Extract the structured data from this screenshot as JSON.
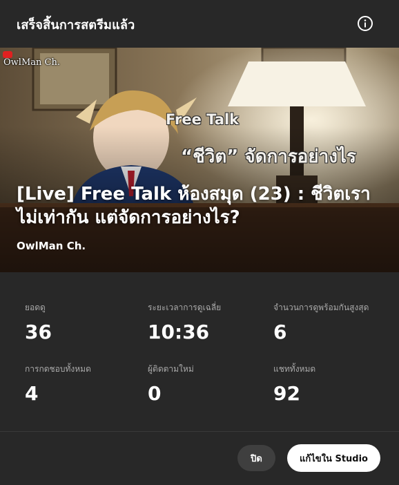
{
  "header": {
    "title": "เสร็จสิ้นการสตรีมแล้ว",
    "info_icon": "info-icon"
  },
  "video": {
    "title": "[Live] Free Talk ห้องสมุด (23) : ชีวิตเรา ไม่เท่ากัน แต่จัดการอย่างไร?",
    "channel": "OwlMan Ch.",
    "thumbnail": {
      "logo_text": "OwlMan Ch.",
      "overlay_line1": "Free Talk",
      "overlay_line2": "“ชีวิต” จัดการอย่างไร"
    }
  },
  "stats": [
    {
      "label": "ยอดดู",
      "value": "36"
    },
    {
      "label": "ระยะเวลาการดูเฉลี่ย",
      "value": "10:36"
    },
    {
      "label": "จำนวนการดูพร้อมกันสูงสุด",
      "value": "6"
    },
    {
      "label": "การกดชอบทั้งหมด",
      "value": "4"
    },
    {
      "label": "ผู้ติดตามใหม่",
      "value": "0"
    },
    {
      "label": "แชททั้งหมด",
      "value": "92"
    }
  ],
  "footer": {
    "close_label": "ปิด",
    "studio_label": "แก้ไขใน Studio"
  },
  "colors": {
    "background": "#282828",
    "label_gray": "#aaaaaa",
    "primary_button": "#ffffff",
    "secondary_button": "#3f3f3f"
  }
}
